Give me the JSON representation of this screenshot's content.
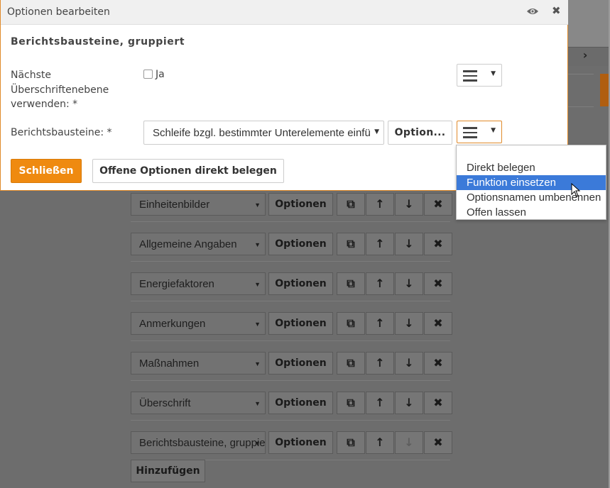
{
  "dialog": {
    "title": "Optionen bearbeiten",
    "section_title": "Berichtsbausteine, gruppiert",
    "next_heading_label_lines": [
      "Nächste",
      "Überschriftenebene",
      "verwenden: *"
    ],
    "checkbox_label": "Ja",
    "checkbox_checked": false,
    "building_blocks_label": "Berichtsbausteine: *",
    "building_blocks_value": "Schleife bzgl. bestimmter Unterelemente einfügen",
    "options_button": "Option...",
    "close_button": "Schließen",
    "fill_open_options_button": "Offene Optionen direkt belegen"
  },
  "dropdown_menu": {
    "items": [
      "Direkt belegen",
      "Funktion einsetzen",
      "Optionsnamen umbenennen",
      "Offen lassen"
    ],
    "selected_index": 1
  },
  "background": {
    "rows": [
      {
        "label": "Einheitenbilder",
        "options": "Optionen"
      },
      {
        "label": "Allgemeine Angaben",
        "options": "Optionen"
      },
      {
        "label": "Energiefaktoren",
        "options": "Optionen"
      },
      {
        "label": "Anmerkungen",
        "options": "Optionen"
      },
      {
        "label": "Maßnahmen",
        "options": "Optionen"
      },
      {
        "label": "Überschrift",
        "options": "Optionen"
      },
      {
        "label": "Berichtsbausteine, gruppiert",
        "options": "Optionen"
      }
    ],
    "add_button": "Hinzufügen"
  },
  "colors": {
    "accent_orange": "#ef8a10",
    "selection_blue": "#3b7ad9",
    "overlay_gray": "#6d6d6d"
  }
}
